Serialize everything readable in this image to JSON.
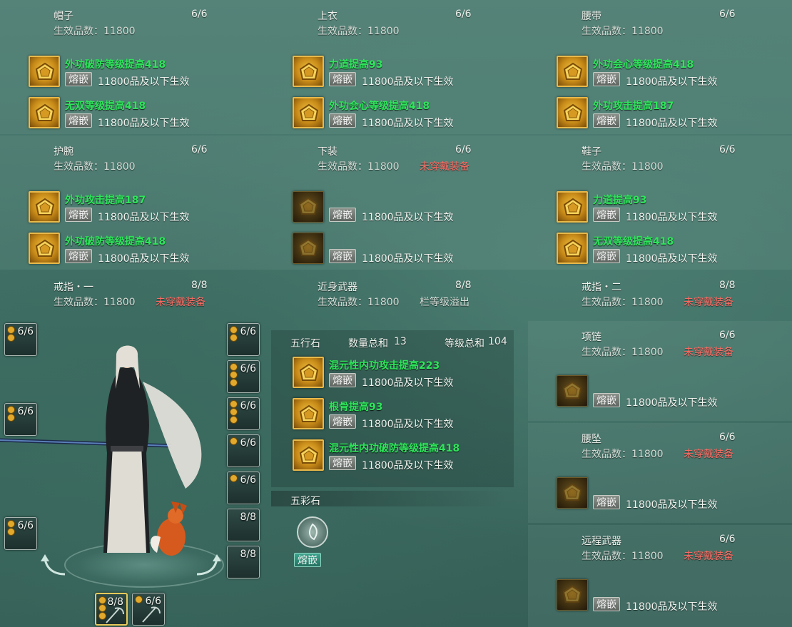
{
  "gem_labels": {
    "inlay_button": "熔嵌",
    "effect_text": "11800品及以下生效"
  },
  "slots": {
    "hat": {
      "title": "帽子",
      "count": "6/6",
      "sub": "生效品数：11800",
      "gems": [
        {
          "name": "外功破防等级提高418"
        },
        {
          "name": "无双等级提高418"
        }
      ]
    },
    "top": {
      "title": "上衣",
      "count": "6/6",
      "sub": "生效品数：11800",
      "gems": [
        {
          "name": "力道提高93"
        },
        {
          "name": "外功会心等级提高418"
        }
      ]
    },
    "belt": {
      "title": "腰带",
      "count": "6/6",
      "sub": "生效品数：11800",
      "gems": [
        {
          "name": "外功会心等级提高418"
        },
        {
          "name": "外功攻击提高187"
        }
      ]
    },
    "wrist": {
      "title": "护腕",
      "count": "6/6",
      "sub": "生效品数：11800",
      "gems": [
        {
          "name": "外功攻击提高187"
        },
        {
          "name": "外功破防等级提高418"
        }
      ]
    },
    "pants": {
      "title": "下装",
      "count": "6/6",
      "sub": "生效品数：11800",
      "warn": "未穿戴装备"
    },
    "shoes": {
      "title": "鞋子",
      "count": "6/6",
      "sub": "生效品数：11800",
      "gems": [
        {
          "name": "力道提高93"
        },
        {
          "name": "无双等级提高418"
        }
      ]
    },
    "ring1": {
      "title": "戒指・一",
      "count": "8/8",
      "sub": "生效品数：11800",
      "warn": "未穿戴装备"
    },
    "melee": {
      "title": "近身武器",
      "count": "8/8",
      "sub": "生效品数：11800",
      "info": "栏等级溢出"
    },
    "ring2": {
      "title": "戒指・二",
      "count": "8/8",
      "sub": "生效品数：11800",
      "warn": "未穿戴装备"
    },
    "necklace": {
      "title": "项链",
      "count": "6/6",
      "sub": "生效品数：11800",
      "warn": "未穿戴装备"
    },
    "pendant": {
      "title": "腰坠",
      "count": "6/6",
      "sub": "生效品数：11800",
      "warn": "未穿戴装备"
    },
    "ranged": {
      "title": "远程武器",
      "count": "6/6",
      "sub": "生效品数：11800",
      "warn": "未穿戴装备"
    }
  },
  "wuxing": {
    "title": "五行石",
    "count_label": "数量总和",
    "count_value": "13",
    "level_label": "等级总和",
    "level_value": "104",
    "gems": [
      {
        "name": "混元性内功攻击提高223"
      },
      {
        "name": "根骨提高93"
      },
      {
        "name": "混元性内功破防等级提高418"
      }
    ]
  },
  "wucai": {
    "title": "五彩石",
    "button": "熔嵌"
  },
  "equip_slots": {
    "left": [
      "6/6",
      "6/6",
      "6/6"
    ],
    "right": [
      "6/6",
      "6/6",
      "6/6",
      "6/6",
      "6/6",
      "8/8",
      "8/8"
    ],
    "bottom": [
      "8/8",
      "6/6"
    ]
  },
  "colors": {
    "gem_green": "#2ee65a",
    "warn_red": "#ff6b63",
    "count_yellow": "#f2d03c",
    "gem_gold": "#e9b94a"
  },
  "icons": [
    "gem-icon",
    "scythe-icon",
    "character-portrait",
    "rotate-left-icon",
    "rotate-right-icon",
    "five-color-stone-icon"
  ]
}
